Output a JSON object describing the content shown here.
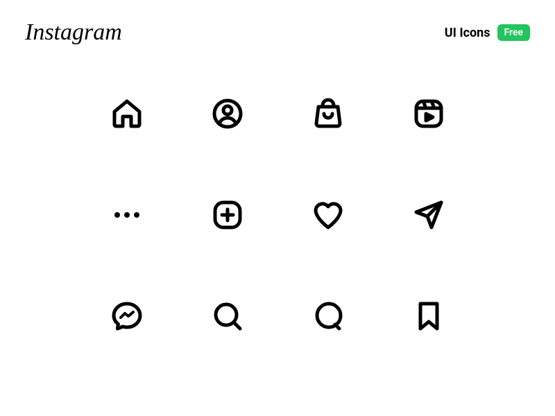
{
  "header": {
    "logo": "Instagram",
    "label": "UI Icons",
    "badge": "Free"
  },
  "icons": [
    {
      "name": "home-icon"
    },
    {
      "name": "profile-icon"
    },
    {
      "name": "shop-icon"
    },
    {
      "name": "reels-icon"
    },
    {
      "name": "more-icon"
    },
    {
      "name": "add-icon"
    },
    {
      "name": "heart-icon"
    },
    {
      "name": "send-icon"
    },
    {
      "name": "messenger-icon"
    },
    {
      "name": "search-icon"
    },
    {
      "name": "comment-icon"
    },
    {
      "name": "bookmark-icon"
    }
  ],
  "colors": {
    "badge_bg": "#22c55e",
    "badge_text": "#ffffff",
    "icon_stroke": "#000000"
  }
}
